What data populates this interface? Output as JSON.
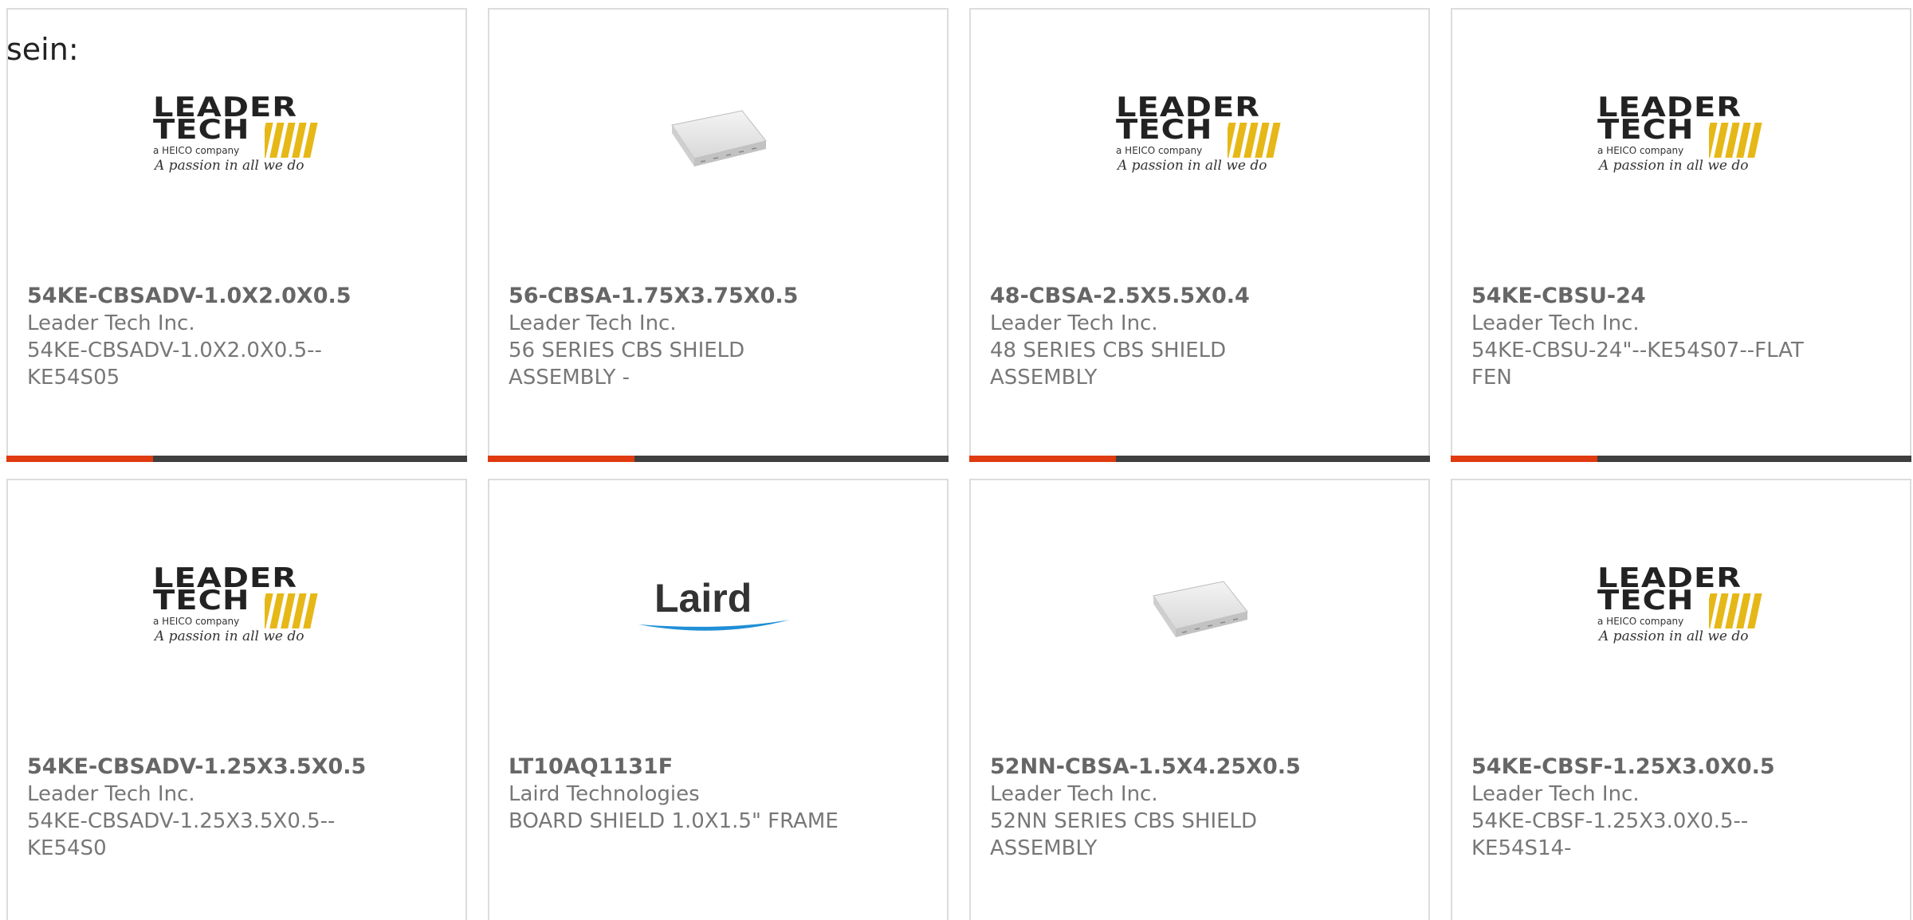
{
  "header": {
    "lead_text": "sein:"
  },
  "colors": {
    "accent": "#e03a10",
    "bar": "#3f3f3f",
    "text": "#777777"
  },
  "products": [
    {
      "part_number": "54KE-CBSADV-1.0X2.0X0.5",
      "manufacturer": "Leader Tech Inc.",
      "description": "54KE-CBSADV-1.0X2.0X0.5--KE54S05",
      "image": "leader-tech-logo"
    },
    {
      "part_number": "56-CBSA-1.75X3.75X0.5",
      "manufacturer": "Leader Tech Inc.",
      "description": "56 SERIES CBS SHIELD ASSEMBLY -",
      "image": "shield-photo"
    },
    {
      "part_number": "48-CBSA-2.5X5.5X0.4",
      "manufacturer": "Leader Tech Inc.",
      "description": "48 SERIES CBS SHIELD ASSEMBLY",
      "image": "leader-tech-logo"
    },
    {
      "part_number": "54KE-CBSU-24",
      "manufacturer": "Leader Tech Inc.",
      "description": "54KE-CBSU-24\"--KE54S07--FLAT FEN",
      "image": "leader-tech-logo"
    },
    {
      "part_number": "54KE-CBSADV-1.25X3.5X0.5",
      "manufacturer": "Leader Tech Inc.",
      "description": "54KE-CBSADV-1.25X3.5X0.5--KE54S0",
      "image": "leader-tech-logo"
    },
    {
      "part_number": "LT10AQ1131F",
      "manufacturer": "Laird Technologies",
      "description": "BOARD SHIELD 1.0X1.5\" FRAME",
      "image": "laird-logo"
    },
    {
      "part_number": "52NN-CBSA-1.5X4.25X0.5",
      "manufacturer": "Leader Tech Inc.",
      "description": "52NN SERIES CBS SHIELD ASSEMBLY",
      "image": "shield-photo"
    },
    {
      "part_number": "54KE-CBSF-1.25X3.0X0.5",
      "manufacturer": "Leader Tech Inc.",
      "description": "54KE-CBSF-1.25X3.0X0.5--KE54S14-",
      "image": "leader-tech-logo"
    }
  ],
  "logos": {
    "leader_tech_line1": "LEADER",
    "leader_tech_line2": "TECH",
    "leader_tech_sub": "a HEICO company",
    "leader_tech_script": "A passion in all we do",
    "laird": "Laird"
  }
}
